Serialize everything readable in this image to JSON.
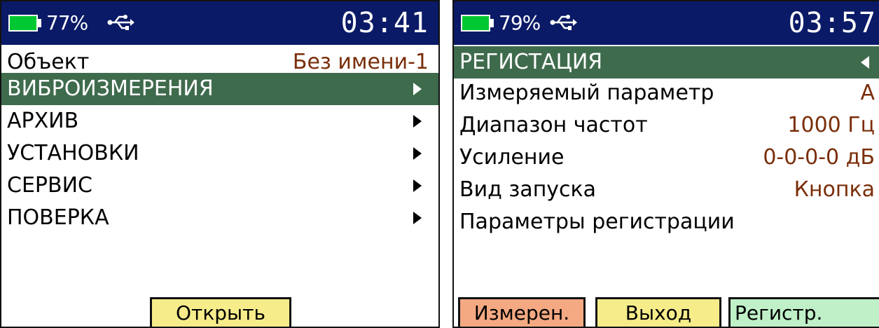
{
  "left_screen": {
    "status": {
      "battery": "77%",
      "time": "03:41"
    },
    "object_row": {
      "label": "Объект",
      "value": "Без имени-1"
    },
    "menu": [
      {
        "label": "ВИБРОИЗМЕРЕНИЯ",
        "selected": true
      },
      {
        "label": "АРХИВ"
      },
      {
        "label": "УСТАНОВКИ"
      },
      {
        "label": "СЕРВИС"
      },
      {
        "label": "ПОВЕРКА"
      }
    ],
    "open_button": "Открыть"
  },
  "right_screen": {
    "status": {
      "battery": "79%",
      "time": "03:57"
    },
    "header": "РЕГИСТАЦИЯ",
    "params": [
      {
        "label": "Измеряемый параметр",
        "value": "А"
      },
      {
        "label": "Диапазон частот",
        "value": "1000 Гц"
      },
      {
        "label": "Усиление",
        "value": "0-0-0-0 дБ"
      },
      {
        "label": "Вид запуска",
        "value": "Кнопка"
      },
      {
        "label": "Параметры регистрации",
        "value": ""
      }
    ],
    "buttons": {
      "measure": "Измерен.",
      "exit": "Выход",
      "register": "Регистр."
    }
  },
  "colors": {
    "statusbar": "#0a1a66",
    "battery_fill": "#00c832",
    "selection": "#3f6b4d",
    "value_text": "#7a2e0a",
    "btn_measure": "#f4a982",
    "btn_exit": "#f6ec8a",
    "btn_register": "#bff0c7"
  },
  "icons": [
    "battery-icon",
    "usb-icon",
    "arrow-right-icon",
    "arrow-left-icon"
  ]
}
